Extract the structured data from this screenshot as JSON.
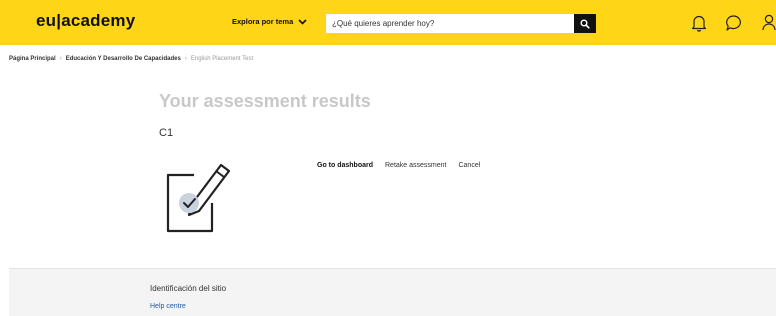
{
  "header": {
    "logo_text": "eu|academy",
    "explore_label": "Explora por tema",
    "search_placeholder": "¿Qué quieres aprender hoy?",
    "icons": [
      "search-icon",
      "bell-icon",
      "chat-bubble-icon",
      "user-icon"
    ],
    "accent_color": "#ffd617"
  },
  "breadcrumb": [
    {
      "label": "Página Principal"
    },
    {
      "label": "Educación Y Desarrollo De Capacidades"
    },
    {
      "label": "English Placement Test"
    }
  ],
  "main": {
    "title": "Your assessment results",
    "level": "C1",
    "illustration_icon": "pen-checklist-icon",
    "actions": {
      "dashboard": "Go to dashboard",
      "retake": "Retake assessment",
      "cancel": "Cancel"
    }
  },
  "footer": {
    "title": "Identificación del sitio",
    "help_link": "Help centre"
  }
}
